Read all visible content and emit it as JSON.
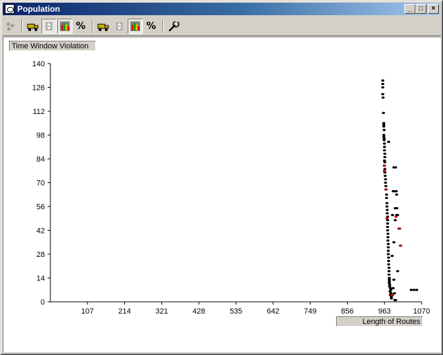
{
  "window": {
    "title": "Population",
    "minimize_glyph": "_",
    "restore_glyph": "□",
    "close_glyph": "×"
  },
  "toolbar": {
    "percent_label_1": "%",
    "percent_label_2": "%"
  },
  "icons": [
    "population-icon",
    "dots-icon",
    "truck-icon",
    "swap-icon",
    "bar-chart-icon",
    "percent-icon",
    "wrench-icon"
  ],
  "colors": {
    "title_bar_start": "#0a246a",
    "title_bar_end": "#a6caf0",
    "point": "#000000",
    "highlight_point": "#c00000"
  },
  "chart_data": {
    "type": "scatter",
    "xlabel": "Length of Routes",
    "ylabel": "Time Window Violation",
    "xlim": [
      0,
      1070
    ],
    "ylim": [
      0,
      140
    ],
    "xticks": [
      107,
      214,
      321,
      428,
      535,
      642,
      749,
      856,
      963,
      1070
    ],
    "yticks": [
      0,
      14,
      28,
      42,
      56,
      70,
      84,
      98,
      112,
      126,
      140
    ],
    "series": [
      {
        "points": [
          [
            958,
            130
          ],
          [
            958,
            128
          ],
          [
            958,
            126
          ],
          [
            958,
            122
          ],
          [
            959,
            120
          ],
          [
            960,
            111
          ],
          [
            961,
            105
          ],
          [
            961,
            104
          ],
          [
            961,
            103
          ],
          [
            962,
            101
          ],
          [
            961,
            98
          ],
          [
            961,
            97
          ],
          [
            962,
            96
          ],
          [
            962,
            95
          ],
          [
            963,
            93
          ],
          [
            963,
            91
          ],
          [
            963,
            89
          ],
          [
            964,
            87
          ],
          [
            964,
            85
          ],
          [
            963,
            83
          ],
          [
            964,
            82
          ],
          [
            963,
            80
          ],
          [
            964,
            78
          ],
          [
            963,
            77
          ],
          [
            964,
            76
          ],
          [
            965,
            74
          ],
          [
            966,
            72
          ],
          [
            966,
            70
          ],
          [
            967,
            68
          ],
          [
            967,
            66
          ],
          [
            969,
            63
          ],
          [
            969,
            61
          ],
          [
            970,
            58
          ],
          [
            970,
            56
          ],
          [
            971,
            54
          ],
          [
            971,
            52
          ],
          [
            972,
            50
          ],
          [
            972,
            48
          ],
          [
            972,
            46
          ],
          [
            972,
            44
          ],
          [
            972,
            42
          ],
          [
            973,
            40
          ],
          [
            973,
            38
          ],
          [
            973,
            36
          ],
          [
            974,
            34
          ],
          [
            974,
            32
          ],
          [
            974,
            30
          ],
          [
            974,
            28
          ],
          [
            975,
            26
          ],
          [
            975,
            24
          ],
          [
            975,
            22
          ],
          [
            976,
            20
          ],
          [
            976,
            18
          ],
          [
            976,
            16
          ],
          [
            977,
            14
          ],
          [
            977,
            13
          ],
          [
            977,
            12
          ],
          [
            977,
            11
          ],
          [
            978,
            10
          ],
          [
            978,
            9
          ],
          [
            980,
            8
          ],
          [
            981,
            7
          ],
          [
            979,
            6
          ],
          [
            982,
            5
          ],
          [
            980,
            4
          ],
          [
            986,
            4
          ],
          [
            983,
            3
          ],
          [
            983,
            2
          ],
          [
            993,
            1
          ],
          [
            988,
            8
          ],
          [
            975,
            94
          ],
          [
            990,
            79
          ],
          [
            995,
            79
          ],
          [
            988,
            65
          ],
          [
            993,
            65
          ],
          [
            997,
            65
          ],
          [
            998,
            63
          ],
          [
            994,
            55
          ],
          [
            999,
            55
          ],
          [
            986,
            51
          ],
          [
            998,
            51
          ],
          [
            1001,
            51
          ],
          [
            994,
            48
          ],
          [
            1005,
            43
          ],
          [
            1009,
            33
          ],
          [
            990,
            13
          ],
          [
            992,
            5
          ],
          [
            995,
            1
          ],
          [
            1040,
            7
          ],
          [
            1048,
            7
          ],
          [
            1056,
            7
          ],
          [
            985,
            27
          ],
          [
            990,
            35
          ],
          [
            1001,
            18
          ]
        ]
      },
      {
        "points": [
          [
            962,
            80
          ],
          [
            963,
            77
          ],
          [
            968,
            66
          ],
          [
            970,
            49
          ],
          [
            996,
            50
          ],
          [
            1007,
            43
          ],
          [
            1010,
            33
          ],
          [
            984,
            4
          ]
        ]
      }
    ]
  }
}
